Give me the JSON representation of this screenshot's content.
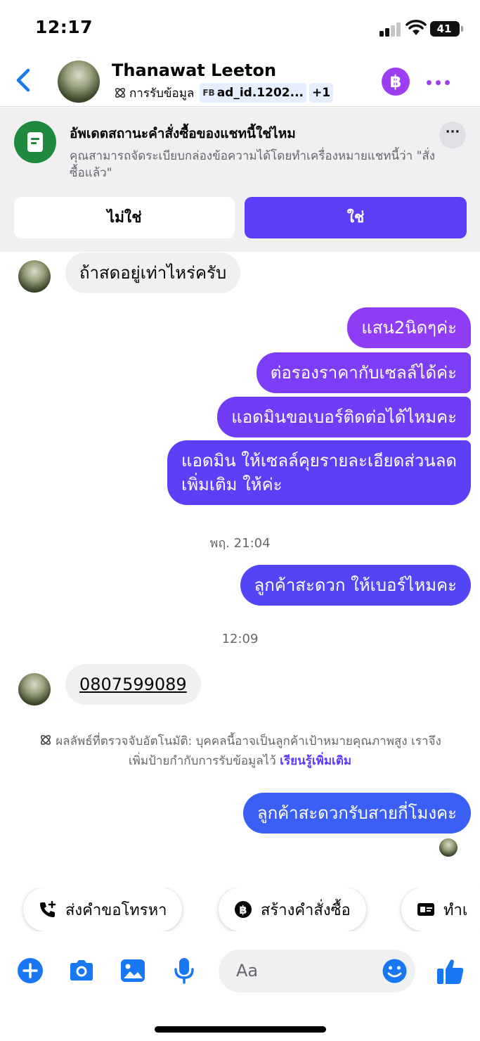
{
  "status_bar": {
    "time": "12:17",
    "battery": "41"
  },
  "header": {
    "back_icon": "chevron-left-icon",
    "contact_name": "Thanawat Leeton",
    "tag_label": "การรับข้อมูล",
    "tag_fb_prefix": "FB",
    "tag_ad": "ad_id.1202...",
    "tag_more": "+1",
    "accent_color": "#9b3ef2"
  },
  "order_prompt": {
    "title": "อัพเดตสถานะคำสั่งซื้อของแชทนี้ใช่ไหม",
    "description": "คุณสามารถจัดระเบียบกล่องข้อความได้โดยทำเครื่องหมายแชทนี้ว่า \"สั่งซื้อแล้ว\"",
    "more_label": "···",
    "no_label": "ไม่ใช่",
    "yes_label": "ใช่",
    "yes_color": "#5b3ef8"
  },
  "messages": {
    "in_1": "ถ้าสดอยู่เท่าไหร่ครับ",
    "out_1": "แสน2นิดๆค่ะ",
    "out_2": "ต่อรองราคากับเซลล์ได้ค่ะ",
    "out_3": "แอดมินขอเบอร์ติดต่อได้ไหมคะ",
    "out_4_line1": "แอดมิน ให้เซลล์คุยรายละเอียดส่วนลด",
    "out_4_line2": "เพิ่มเติม ให้ค่ะ",
    "time_1": "พฤ. 21:04",
    "out_5": "ลูกค้าสะดวก ให้เบอร์ไหมคะ",
    "time_2": "12:09",
    "in_2": "0807599089",
    "auto_note_line1": "ผลลัพธ์ที่ตรวจจับอัตโนมัติ: บุคคลนี้อาจเป็นลูกค้าเป้าหมายคุณภาพสูง เราจึง",
    "auto_note_line2": "เพิ่มป้ายกำกับการรับข้อมูลไว้",
    "learn_more": "เรียนรู้เพิ่มเติม",
    "out_6": "ลูกค้าสะดวกรับสายกี่โมงคะ"
  },
  "quick_actions": [
    {
      "icon": "phone-plus-icon",
      "label": "ส่งคำขอโทรหา"
    },
    {
      "icon": "baht-icon",
      "label": "สร้างคำสั่งซื้อ"
    },
    {
      "icon": "card-icon",
      "label": "ทำเ"
    }
  ],
  "composer": {
    "placeholder": "Aa",
    "icons": [
      "plus-icon",
      "camera-icon",
      "image-icon",
      "microphone-icon",
      "emoji-icon",
      "thumbs-up-icon"
    ],
    "icon_color": "#1877f2"
  }
}
